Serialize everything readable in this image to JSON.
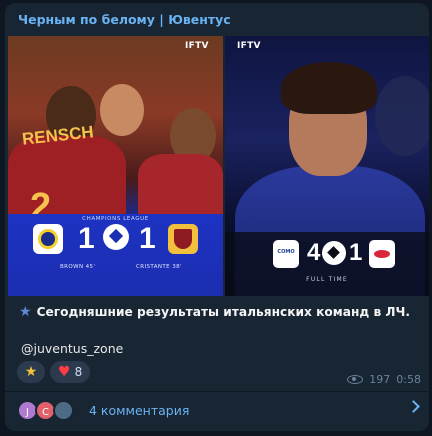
{
  "post": {
    "channel_name": "Черным по белому | Ювентус",
    "caption": "Сегодняшние результаты итальянских команд в ЛЧ.",
    "mention": "@juventus_zone",
    "views": "197",
    "time": "0:58"
  },
  "media_left": {
    "watermark": "IFTV",
    "shirt_name": "RENSCH",
    "shirt_number": "2",
    "competition": "CHAMPIONS LEAGUE",
    "home_score": "1",
    "away_score": "1",
    "home_scorer": "BROWN",
    "home_scorer_minute": "45'",
    "away_scorer": "CRISTANTE",
    "away_scorer_minute": "38'"
  },
  "media_right": {
    "watermark": "IFTV",
    "home_score": "4",
    "away_score": "1",
    "home_badge": "COMO",
    "status": "FULL TIME"
  },
  "reactions": [
    {
      "icon": "star-icon",
      "count": ""
    },
    {
      "icon": "heart-icon",
      "count": "8"
    }
  ],
  "comments": {
    "label": "4 комментария",
    "avatars": [
      {
        "initial": "J",
        "color": "#b07ad1"
      },
      {
        "initial": "C",
        "color": "#e0616a"
      },
      {
        "initial": "",
        "color": "#4e6b86"
      }
    ]
  },
  "colors": {
    "background": "#0e1621",
    "bubble": "#182533",
    "accent": "#6ab3f3"
  }
}
